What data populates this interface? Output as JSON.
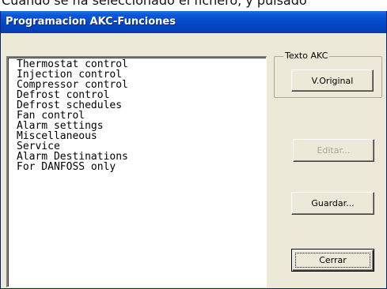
{
  "background_caption": "Cuando se ha seleccionado el fichero, y pulsado",
  "window": {
    "title": "Programacion AKC-Funciones"
  },
  "function_list": {
    "items": [
      "Thermostat control",
      "Injection control",
      "Compressor control",
      "Defrost control",
      "Defrost schedules",
      "Fan control",
      "Alarm settings",
      "Miscellaneous",
      "Service",
      "Alarm Destinations",
      "For DANFOSS only"
    ]
  },
  "texto_akc": {
    "label": "Texto AKC",
    "original_button": "V.Original"
  },
  "buttons": {
    "editar": "Editar...",
    "guardar": "Guardar...",
    "cerrar": "Cerrar"
  },
  "colors": {
    "titlebar": "#0348c8",
    "dialog_bg": "#ece9d8",
    "disabled_text": "#aca899"
  },
  "states": {
    "editar_disabled": true,
    "cerrar_focused": true
  }
}
